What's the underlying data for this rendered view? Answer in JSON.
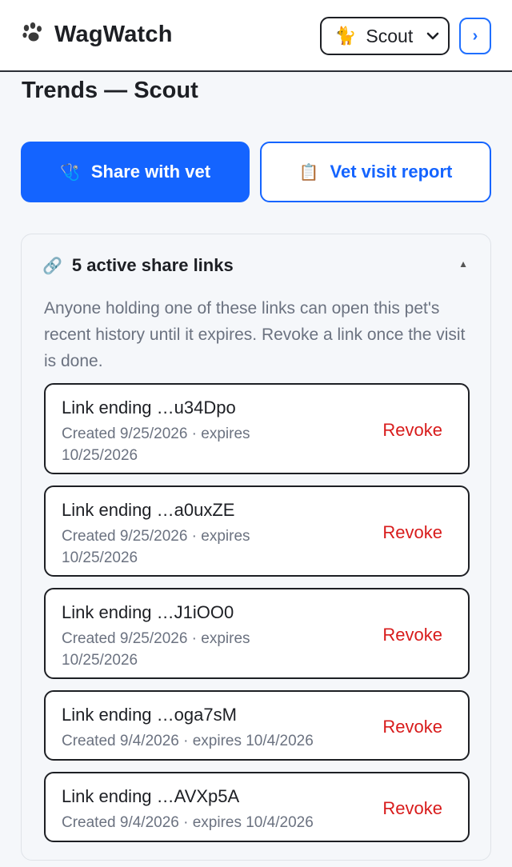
{
  "app": {
    "name": "WagWatch",
    "logo_icon": "paw-icon"
  },
  "header": {
    "pet_selector": {
      "icon": "cat-icon",
      "selected": "Scout"
    },
    "next_button": "›"
  },
  "page": {
    "title": "Trends — Scout"
  },
  "actions": {
    "share_with_vet": {
      "icon": "stethoscope-icon",
      "label": "Share with vet"
    },
    "vet_visit_report": {
      "icon": "clipboard-icon",
      "label": "Vet visit report"
    }
  },
  "share_links": {
    "icon": "link-icon",
    "title": "5 active share links",
    "collapse_indicator": "▲",
    "description": "Anyone holding one of these links can open this pet's recent history until it expires. Revoke a link once the visit is done.",
    "revoke_label": "Revoke",
    "items": [
      {
        "name": "Link ending …u34Dpo",
        "meta": "Created 9/25/2026 · expires 10/25/2026"
      },
      {
        "name": "Link ending …a0uxZE",
        "meta": "Created 9/25/2026 · expires 10/25/2026"
      },
      {
        "name": "Link ending …J1iOO0",
        "meta": "Created 9/25/2026 · expires 10/25/2026"
      },
      {
        "name": "Link ending …oga7sM",
        "meta": "Created 9/4/2026 · expires 10/4/2026"
      },
      {
        "name": "Link ending …AVXp5A",
        "meta": "Created 9/4/2026 · expires 10/4/2026"
      }
    ]
  },
  "colors": {
    "primary": "#1464ff",
    "danger": "#d81b1b",
    "muted_text": "#6b7280",
    "background": "#f5f7fa"
  }
}
